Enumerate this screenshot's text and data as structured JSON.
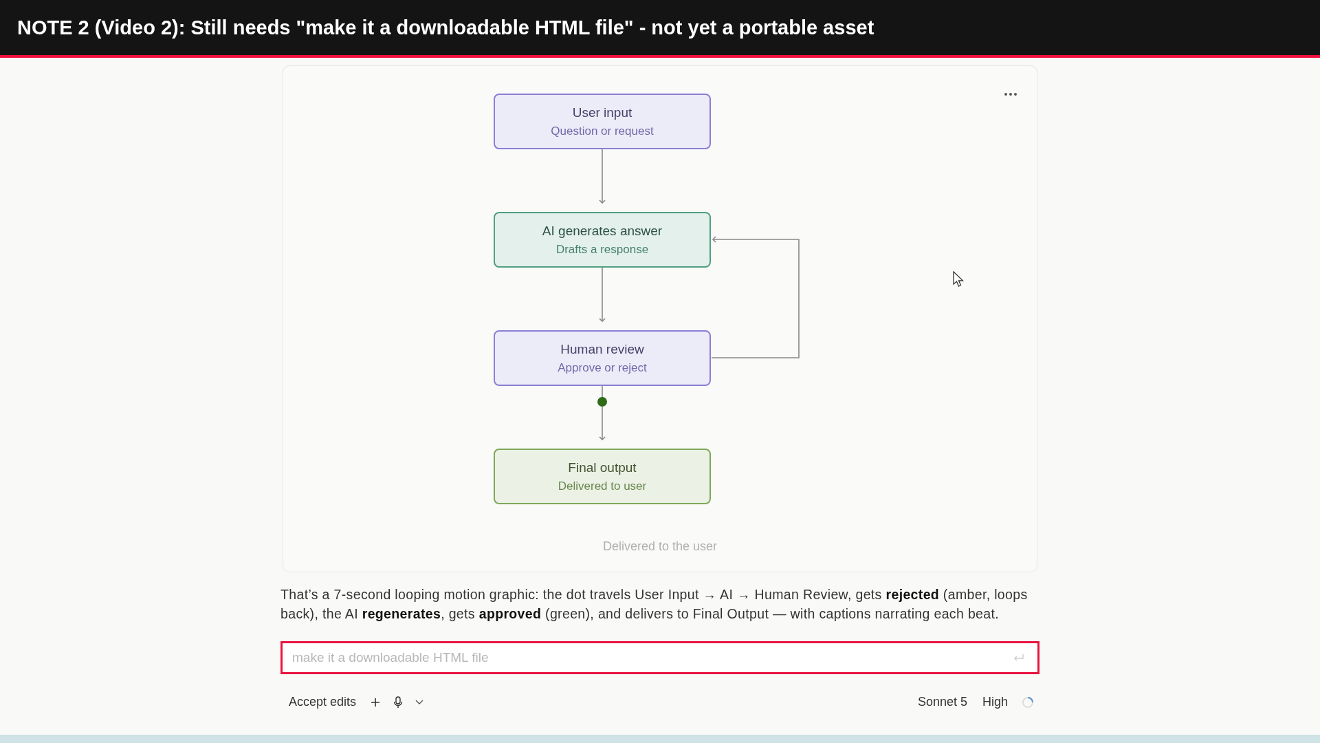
{
  "banner": {
    "title": "NOTE 2 (Video 2): Still needs \"make it a downloadable HTML file\" - not yet a portable asset"
  },
  "diagram": {
    "nodes": [
      {
        "title": "User input",
        "subtitle": "Question or request",
        "color": "#8a7fd6"
      },
      {
        "title": "AI generates answer",
        "subtitle": "Drafts a response",
        "color": "#4f9f84"
      },
      {
        "title": "Human review",
        "subtitle": "Approve or reject",
        "color": "#8a7fd6"
      },
      {
        "title": "Final output",
        "subtitle": "Delivered to user",
        "color": "#7fa85a"
      }
    ],
    "caption": "Delivered to the user"
  },
  "message": "That’s a 7-second looping motion graphic: the dot travels User Input → AI → Human Review, gets **rejected** (amber, loops back), the AI **regenerates**, gets **approved** (green), and delivers to Final Output — with captions narrating each beat.",
  "composer": {
    "placeholder": "make it a downloadable HTML file"
  },
  "toolbar": {
    "mode": "Accept edits",
    "model": "Sonnet 5",
    "effort": "High"
  }
}
